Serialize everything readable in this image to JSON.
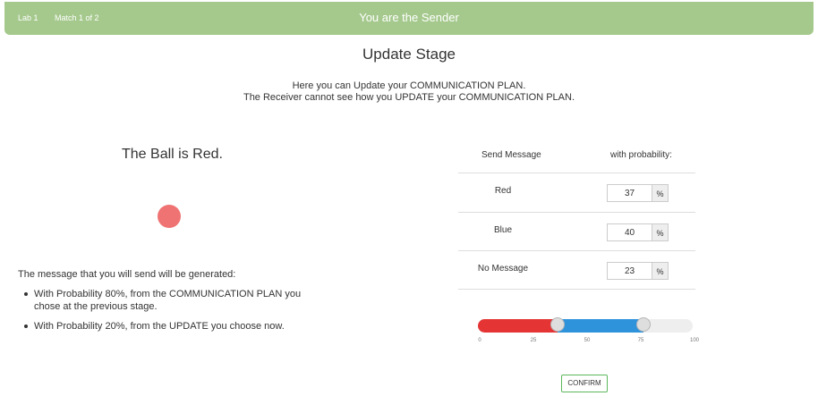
{
  "header": {
    "lab": "Lab 1",
    "match": "Match 1 of 2",
    "role": "You are the Sender"
  },
  "stage_title": "Update Stage",
  "intro": [
    "Here you can Update your COMMUNICATION PLAN.",
    "The Receiver cannot see how you UPDATE your COMMUNICATION PLAN."
  ],
  "ball": {
    "text": "The Ball is Red.",
    "color": "#ef7373"
  },
  "generation": {
    "text": "The message that you will send will be generated:",
    "bullets": [
      "With Probability 80%, from the COMMUNICATION PLAN you chose at the previous stage.",
      "With Probability 20%, from the UPDATE you choose now."
    ]
  },
  "table": {
    "col1": "Send Message",
    "col2": "with probability:",
    "rows": [
      {
        "label": "Red",
        "value": "37",
        "unit": "%"
      },
      {
        "label": "Blue",
        "value": "40",
        "unit": "%"
      },
      {
        "label": "No Message",
        "value": "23",
        "unit": "%"
      }
    ]
  },
  "slider": {
    "handles": [
      37,
      77
    ],
    "ticks": [
      "0",
      "25",
      "50",
      "75",
      "100"
    ],
    "colors": {
      "red": "#e53434",
      "blue": "#2f93dc",
      "empty": "#eeeeee"
    }
  },
  "confirm_label": "CONFIRM"
}
